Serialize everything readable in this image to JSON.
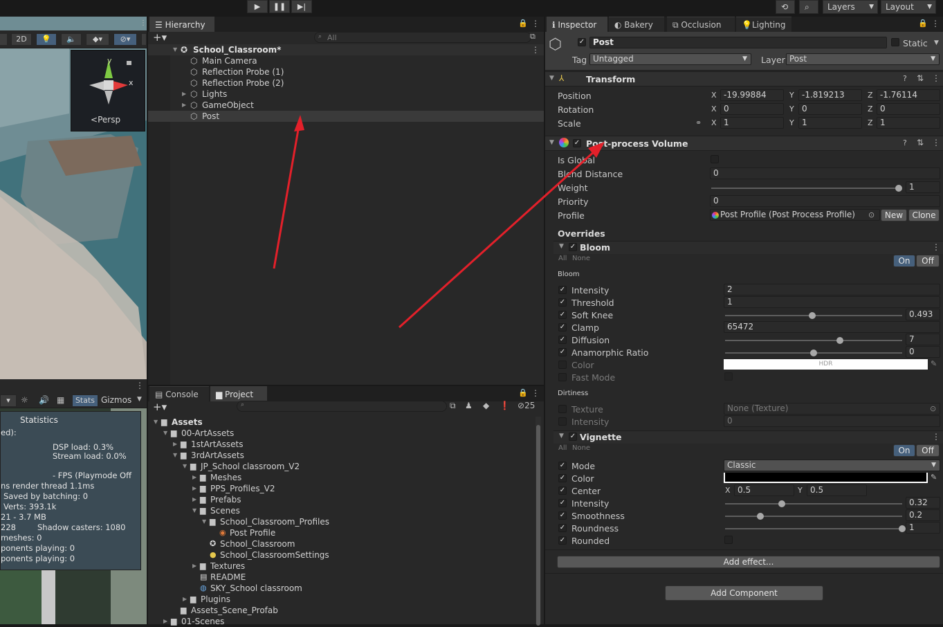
{
  "toolbar": {
    "layers_label": "Layers",
    "layout_label": "Layout"
  },
  "scene": {
    "mode_2d": "2D",
    "persp_label": "Persp",
    "axis_y": "y",
    "axis_x": "x"
  },
  "game": {
    "stats_label": "Stats",
    "gizmos_label": "Gizmos"
  },
  "statistics": {
    "title": "Statistics",
    "lines": [
      "ed):",
      "DSP load: 0.3%",
      "Stream load: 0.0%",
      "- FPS (Playmode Off",
      "ns  render thread 1.1ms",
      "Saved by batching: 0",
      "Verts: 393.1k",
      "21 - 3.7 MB",
      "228",
      "Shadow casters: 1080",
      "meshes: 0",
      "ponents playing: 0",
      "ponents playing: 0"
    ]
  },
  "hierarchy": {
    "tab": "Hierarchy",
    "search_placeholder": "All",
    "scene_name": "School_Classroom*",
    "items": [
      {
        "label": "Main Camera",
        "expandable": false
      },
      {
        "label": "Reflection Probe (1)",
        "expandable": false
      },
      {
        "label": "Reflection Probe (2)",
        "expandable": false
      },
      {
        "label": "Lights",
        "expandable": true
      },
      {
        "label": "GameObject",
        "expandable": true
      },
      {
        "label": "Post",
        "expandable": false
      }
    ]
  },
  "project": {
    "tabs": [
      "Console",
      "Project"
    ],
    "hidden_count": "25",
    "tree": [
      {
        "label": "Assets",
        "depth": 0,
        "icon": "folder",
        "open": true
      },
      {
        "label": "00-ArtAssets",
        "depth": 1,
        "icon": "folder",
        "open": true
      },
      {
        "label": "1stArtAssets",
        "depth": 2,
        "icon": "folder",
        "open": false
      },
      {
        "label": "3rdArtAssets",
        "depth": 2,
        "icon": "folder",
        "open": true
      },
      {
        "label": "JP_School classroom_V2",
        "depth": 3,
        "icon": "folder",
        "open": true
      },
      {
        "label": "Meshes",
        "depth": 4,
        "icon": "folder",
        "open": false
      },
      {
        "label": "PPS_Profiles_V2",
        "depth": 4,
        "icon": "folder",
        "open": false
      },
      {
        "label": "Prefabs",
        "depth": 4,
        "icon": "folder",
        "open": false
      },
      {
        "label": "Scenes",
        "depth": 4,
        "icon": "folder",
        "open": true
      },
      {
        "label": "School_Classroom_Profiles",
        "depth": 5,
        "icon": "folder",
        "open": true
      },
      {
        "label": "Post Profile",
        "depth": 6,
        "icon": "profile",
        "open": null
      },
      {
        "label": "School_Classroom",
        "depth": 5,
        "icon": "unity",
        "open": null
      },
      {
        "label": "School_ClassroomSettings",
        "depth": 5,
        "icon": "settings",
        "open": null
      },
      {
        "label": "Textures",
        "depth": 4,
        "icon": "folder",
        "open": false
      },
      {
        "label": "README",
        "depth": 4,
        "icon": "doc",
        "open": null
      },
      {
        "label": "SKY_School classroom",
        "depth": 4,
        "icon": "sky",
        "open": null
      },
      {
        "label": "Plugins",
        "depth": 3,
        "icon": "folder",
        "open": false
      },
      {
        "label": "Assets_Scene_Profab",
        "depth": 2,
        "icon": "folder",
        "open": null
      },
      {
        "label": "01-Scenes",
        "depth": 1,
        "icon": "folder",
        "open": false
      }
    ]
  },
  "inspector": {
    "tabs": [
      "Inspector",
      "Bakery",
      "Occlusion",
      "Lighting"
    ],
    "object_name": "Post",
    "static_label": "Static",
    "tag_label": "Tag",
    "tag_value": "Untagged",
    "layer_label": "Layer",
    "layer_value": "Post",
    "transform": {
      "title": "Transform",
      "position_label": "Position",
      "rotation_label": "Rotation",
      "scale_label": "Scale",
      "position": [
        "-19.99884",
        "-1.819213",
        "-1.76114"
      ],
      "rotation": [
        "0",
        "0",
        "0"
      ],
      "scale": [
        "1",
        "1",
        "1"
      ],
      "axes": [
        "X",
        "Y",
        "Z"
      ]
    },
    "ppv": {
      "title": "Post-process Volume",
      "is_global": "Is Global",
      "blend_distance": "Blend Distance",
      "blend_value": "0",
      "weight": "Weight",
      "weight_value": "1",
      "priority": "Priority",
      "priority_value": "0",
      "profile": "Profile",
      "profile_value": "Post Profile (Post Process Profile)",
      "new": "New",
      "clone": "Clone",
      "overrides": "Overrides"
    },
    "bloom": {
      "title": "Bloom",
      "all": "All",
      "none": "None",
      "on": "On",
      "off": "Off",
      "section": "Bloom",
      "params": [
        {
          "label": "Intensity",
          "value": "2",
          "type": "field",
          "checked": true
        },
        {
          "label": "Threshold",
          "value": "1",
          "type": "field",
          "checked": true
        },
        {
          "label": "Soft Knee",
          "value": "0.493",
          "type": "slider",
          "pos": 0.493,
          "checked": true
        },
        {
          "label": "Clamp",
          "value": "65472",
          "type": "field",
          "checked": true
        },
        {
          "label": "Diffusion",
          "value": "7",
          "type": "slider",
          "pos": 0.65,
          "checked": true
        },
        {
          "label": "Anamorphic Ratio",
          "value": "0",
          "type": "slider",
          "pos": 0.5,
          "checked": true
        },
        {
          "label": "Color",
          "value": "HDR",
          "type": "color",
          "checked": false
        },
        {
          "label": "Fast Mode",
          "value": "",
          "type": "toggle",
          "checked": false
        }
      ],
      "dirtiness": "Dirtiness",
      "dirt_texture": "Texture",
      "dirt_texture_value": "None (Texture)",
      "dirt_intensity": "Intensity",
      "dirt_intensity_value": "0"
    },
    "vignette": {
      "title": "Vignette",
      "all": "All",
      "none": "None",
      "on": "On",
      "off": "Off",
      "mode_label": "Mode",
      "mode_value": "Classic",
      "color_label": "Color",
      "center_label": "Center",
      "center_x": "0.5",
      "center_y": "0.5",
      "intensity_label": "Intensity",
      "intensity_value": "0.32",
      "smoothness_label": "Smoothness",
      "smoothness_value": "0.2",
      "roundness_label": "Roundness",
      "roundness_value": "1",
      "rounded_label": "Rounded"
    },
    "add_effect": "Add effect...",
    "add_component": "Add Component"
  }
}
